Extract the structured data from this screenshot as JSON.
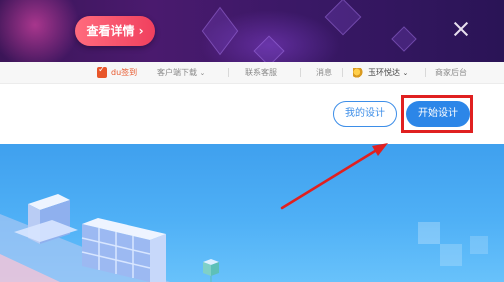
{
  "banner": {
    "detail_button": "查看详情 ›"
  },
  "topnav": {
    "sign_in": "du签到",
    "client_download": "客户端下载",
    "support": "联系客服",
    "messages": "消息",
    "account": "玉环悦达",
    "merchant": "商家后台"
  },
  "actions": {
    "my_design": "我的设计",
    "start_design": "开始设计"
  },
  "colors": {
    "accent": "#2c86e8",
    "highlight": "#e02020",
    "banner_button": "#f0405e"
  }
}
